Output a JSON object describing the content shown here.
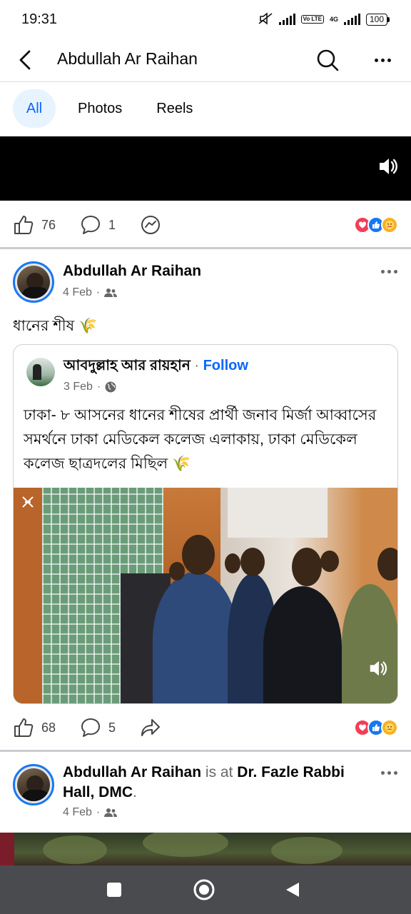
{
  "status_bar": {
    "time": "19:31",
    "network": "4G",
    "lte": "Vo LTE",
    "battery": "100"
  },
  "header": {
    "title": "Abdullah Ar Raihan",
    "icons": [
      "back-arrow-icon",
      "search-icon",
      "more-icon"
    ]
  },
  "tabs": [
    {
      "label": "All",
      "active": true
    },
    {
      "label": "Photos",
      "active": false
    },
    {
      "label": "Reels",
      "active": false
    }
  ],
  "video_post": {
    "likes": "76",
    "comments": "1"
  },
  "post2": {
    "author": "Abdullah Ar Raihan",
    "date": "4 Feb",
    "text": "ধানের শীষ",
    "text_emoji": "🌾",
    "shared": {
      "author": "আবদুল্লাহ আর রায়হান",
      "separator": "·",
      "follow_label": "Follow",
      "date": "3 Feb",
      "text": "ঢাকা- ৮ আসনের ধানের শীষের প্রার্থী জনাব মির্জা আব্বাসের সমর্থনে ঢাকা মেডিকেল কলেজ এলাকায়, ঢাকা মেডিকেল কলেজ ছাত্রদলের মিছিল",
      "text_emoji": "🌾"
    },
    "likes": "68",
    "comments": "5"
  },
  "post3": {
    "author": "Abdullah Ar Raihan",
    "is_at": "is at",
    "place": "Dr. Fazle Rabbi Hall, DMC",
    "place_end": ".",
    "date": "4 Feb"
  },
  "colors": {
    "accent": "#0866ff",
    "tab_active_bg": "#e7f3ff",
    "love": "#f33e58",
    "like": "#1877f2",
    "care": "#f7b125",
    "nav_bar": "#4a4b4e"
  }
}
